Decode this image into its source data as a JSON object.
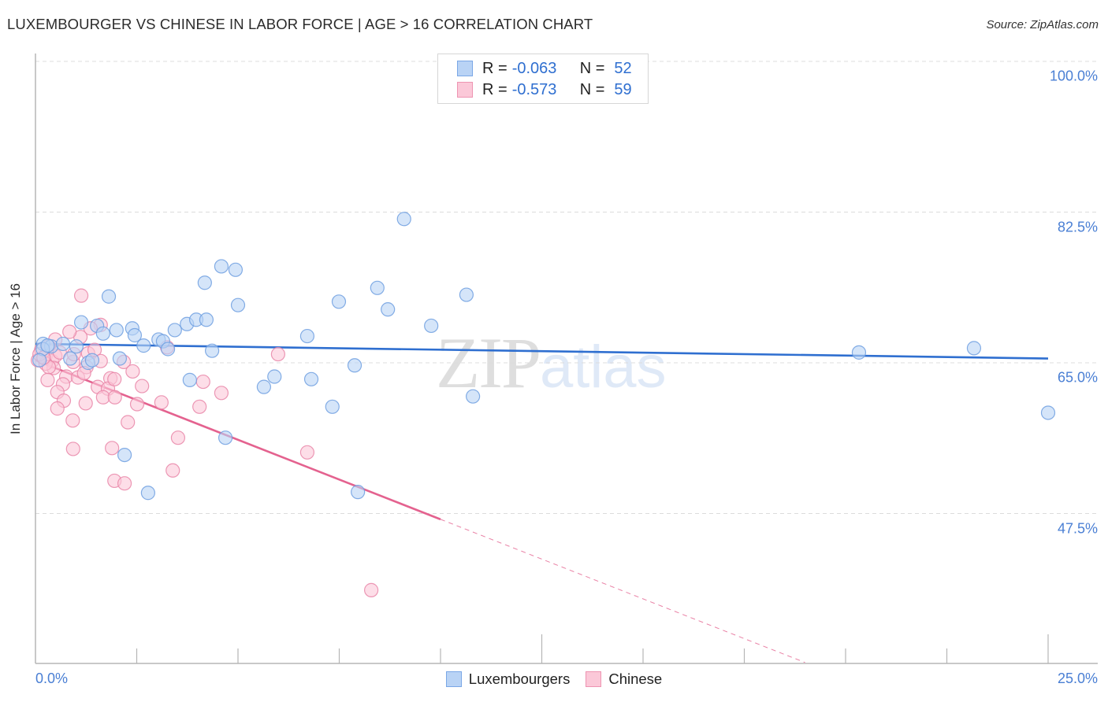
{
  "header": {
    "title": "LUXEMBOURGER VS CHINESE IN LABOR FORCE | AGE > 16 CORRELATION CHART",
    "source": "Source: ZipAtlas.com"
  },
  "watermark": {
    "zip": "ZIP",
    "atlas": "atlas"
  },
  "legend": {
    "rows": [
      {
        "r_label": "R =",
        "r_value": "-0.063",
        "n_label": "N =",
        "n_value": "52",
        "color": "#b9d3f5",
        "border": "#7aa7e6"
      },
      {
        "r_label": "R =",
        "r_value": "-0.573",
        "n_label": "N =",
        "n_value": "59",
        "color": "#fbc8d8",
        "border": "#ee94b2"
      }
    ]
  },
  "bottom_legend": {
    "items": [
      {
        "label": "Luxembourgers",
        "color": "#b9d3f5",
        "border": "#7aa7e6"
      },
      {
        "label": "Chinese",
        "color": "#fbc8d8",
        "border": "#ee94b2"
      }
    ]
  },
  "chart_data": {
    "type": "scatter",
    "title": "LUXEMBOURGER VS CHINESE IN LABOR FORCE | AGE > 16 CORRELATION CHART",
    "xlabel": "",
    "ylabel": "In Labor Force | Age > 16",
    "xlim": [
      0,
      25
    ],
    "ylim": [
      31.3,
      100.6
    ],
    "x_tick_labels": [
      "0.0%",
      "25.0%"
    ],
    "y_ticks": [
      100.0,
      82.5,
      65.0,
      47.5
    ],
    "y_tick_labels": [
      "100.0%",
      "82.5%",
      "65.0%",
      "47.5%"
    ],
    "grid": true,
    "legend_position": "top-center",
    "series": [
      {
        "name": "Luxembourgers",
        "color": "#6f9fe0",
        "fill": "#b9d3f5",
        "R": -0.063,
        "N": 52,
        "trend": {
          "x0": 0,
          "y0": 67.2,
          "x1": 25,
          "y1": 65.5,
          "solid_until": 25
        },
        "points": [
          [
            9.1,
            81.7
          ],
          [
            4.59,
            76.2
          ],
          [
            4.94,
            75.8
          ],
          [
            4.18,
            74.3
          ],
          [
            5.0,
            71.7
          ],
          [
            1.81,
            72.7
          ],
          [
            7.49,
            72.1
          ],
          [
            8.44,
            73.7
          ],
          [
            8.7,
            71.2
          ],
          [
            10.64,
            72.9
          ],
          [
            9.77,
            69.3
          ],
          [
            6.71,
            68.1
          ],
          [
            1.52,
            69.3
          ],
          [
            1.13,
            69.7
          ],
          [
            2.0,
            68.8
          ],
          [
            1.67,
            68.4
          ],
          [
            2.39,
            69.0
          ],
          [
            2.45,
            68.2
          ],
          [
            3.04,
            67.7
          ],
          [
            3.15,
            67.5
          ],
          [
            2.67,
            67.0
          ],
          [
            3.44,
            68.8
          ],
          [
            3.74,
            69.5
          ],
          [
            3.97,
            70.0
          ],
          [
            4.22,
            70.0
          ],
          [
            3.27,
            66.6
          ],
          [
            4.36,
            66.4
          ],
          [
            0.19,
            67.2
          ],
          [
            0.39,
            66.9
          ],
          [
            0.68,
            67.2
          ],
          [
            1.01,
            66.9
          ],
          [
            0.18,
            66.6
          ],
          [
            0.1,
            65.3
          ],
          [
            0.86,
            65.5
          ],
          [
            1.3,
            65.0
          ],
          [
            1.4,
            65.3
          ],
          [
            2.08,
            65.5
          ],
          [
            7.88,
            64.7
          ],
          [
            5.9,
            63.4
          ],
          [
            6.81,
            63.1
          ],
          [
            3.81,
            63.0
          ],
          [
            5.64,
            62.2
          ],
          [
            7.33,
            59.9
          ],
          [
            10.8,
            61.1
          ],
          [
            20.33,
            66.2
          ],
          [
            23.17,
            66.7
          ],
          [
            25.0,
            59.2
          ],
          [
            2.2,
            54.3
          ],
          [
            4.69,
            56.3
          ],
          [
            2.78,
            49.9
          ],
          [
            7.96,
            50.0
          ],
          [
            0.3,
            67.0
          ]
        ]
      },
      {
        "name": "Chinese",
        "color": "#e986a8",
        "fill": "#fbc8d8",
        "R": -0.573,
        "N": 59,
        "trend": {
          "x0": 0,
          "y0": 65.3,
          "x1": 19.0,
          "y1": 30.2,
          "solid_until": 10.0
        },
        "points": [
          [
            1.13,
            72.8
          ],
          [
            1.61,
            69.4
          ],
          [
            1.36,
            69.0
          ],
          [
            1.11,
            68.0
          ],
          [
            0.49,
            67.7
          ],
          [
            0.84,
            68.6
          ],
          [
            3.25,
            66.8
          ],
          [
            5.99,
            66.0
          ],
          [
            0.14,
            66.5
          ],
          [
            0.25,
            65.8
          ],
          [
            0.33,
            66.9
          ],
          [
            0.06,
            65.3
          ],
          [
            0.41,
            65.2
          ],
          [
            0.49,
            65.8
          ],
          [
            0.45,
            64.4
          ],
          [
            0.25,
            64.9
          ],
          [
            1.3,
            66.1
          ],
          [
            1.46,
            66.5
          ],
          [
            0.93,
            65.1
          ],
          [
            1.61,
            65.2
          ],
          [
            2.18,
            65.1
          ],
          [
            1.26,
            64.5
          ],
          [
            0.76,
            63.4
          ],
          [
            1.05,
            63.3
          ],
          [
            1.85,
            63.2
          ],
          [
            0.68,
            62.5
          ],
          [
            0.33,
            64.5
          ],
          [
            0.54,
            61.6
          ],
          [
            0.7,
            60.6
          ],
          [
            0.54,
            59.7
          ],
          [
            1.24,
            60.3
          ],
          [
            1.54,
            62.2
          ],
          [
            1.79,
            62.0
          ],
          [
            1.67,
            61.0
          ],
          [
            1.96,
            61.0
          ],
          [
            2.63,
            62.3
          ],
          [
            1.95,
            63.1
          ],
          [
            2.51,
            60.2
          ],
          [
            3.11,
            60.4
          ],
          [
            4.05,
            59.9
          ],
          [
            4.59,
            61.5
          ],
          [
            4.14,
            62.8
          ],
          [
            0.92,
            58.3
          ],
          [
            2.28,
            58.1
          ],
          [
            0.93,
            55.0
          ],
          [
            1.89,
            55.1
          ],
          [
            3.52,
            56.3
          ],
          [
            6.71,
            54.6
          ],
          [
            1.95,
            51.3
          ],
          [
            2.2,
            51.0
          ],
          [
            3.39,
            52.5
          ],
          [
            8.29,
            38.6
          ],
          [
            0.1,
            66.0
          ],
          [
            0.2,
            65.6
          ],
          [
            0.6,
            66.2
          ],
          [
            0.95,
            66.0
          ],
          [
            1.2,
            63.8
          ],
          [
            0.3,
            63.0
          ],
          [
            2.4,
            64.0
          ]
        ]
      }
    ]
  }
}
